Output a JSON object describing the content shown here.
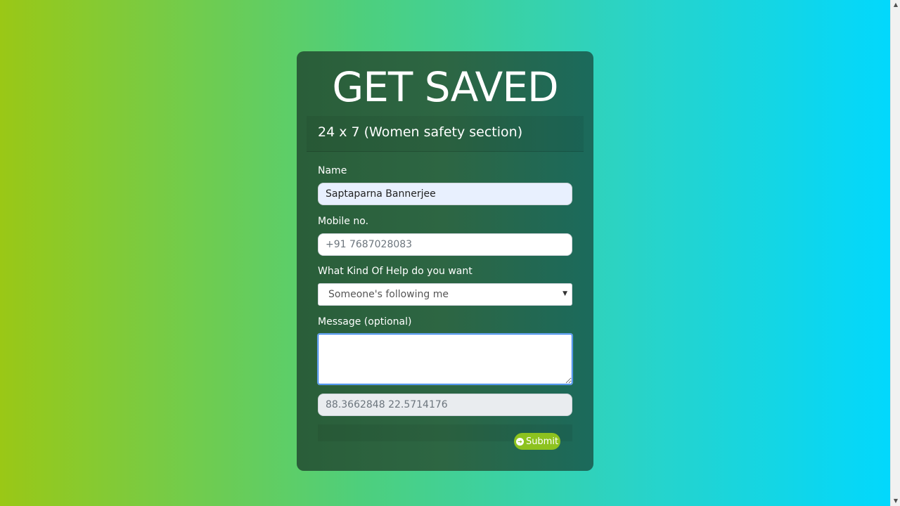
{
  "form": {
    "title": "GET SAVED",
    "subtitle": "24 x 7 (Women safety section)",
    "name_label": "Name",
    "name_value": "Saptaparna Bannerjee",
    "mobile_label": "Mobile no.",
    "mobile_placeholder": "+91 7687028083",
    "help_label": "What Kind Of Help do you want",
    "help_selected": "Someone's following me",
    "message_label": "Message (optional)",
    "message_value": "",
    "coordinates": "88.3662848 22.5714176",
    "submit_label": "Submit"
  },
  "icons": {
    "submit": "arrow-right-circle-icon",
    "select": "caret-down-icon"
  },
  "colors": {
    "submit_button": "#8dc21f",
    "card_background": "#2d6643"
  }
}
